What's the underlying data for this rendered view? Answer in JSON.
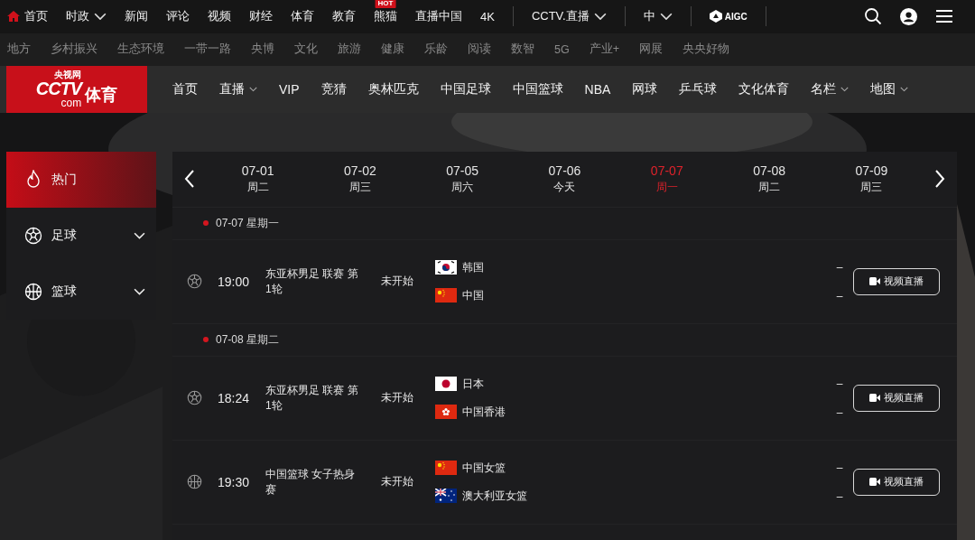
{
  "top_nav": {
    "items": [
      {
        "label": "首页",
        "home": true,
        "menu": false
      },
      {
        "label": "时政",
        "home": false,
        "menu": true
      },
      {
        "label": "新闻",
        "home": false,
        "menu": false
      },
      {
        "label": "评论",
        "home": false,
        "menu": false
      },
      {
        "label": "视频",
        "home": false,
        "menu": false
      },
      {
        "label": "财经",
        "home": false,
        "menu": false
      },
      {
        "label": "体育",
        "home": false,
        "menu": false
      },
      {
        "label": "教育",
        "home": false,
        "menu": false
      },
      {
        "label": "熊猫",
        "home": false,
        "menu": false,
        "badge": "HOT"
      },
      {
        "label": "直播中国",
        "home": false,
        "menu": false
      },
      {
        "label": "4K",
        "home": false,
        "menu": false
      }
    ],
    "live": {
      "label": "CCTV.直播"
    },
    "language": {
      "label": "中"
    },
    "aigc": {
      "label": "AIGC"
    }
  },
  "channel_nav": [
    "地方",
    "乡村振兴",
    "生态环境",
    "一带一路",
    "央博",
    "文化",
    "旅游",
    "健康",
    "乐龄",
    "阅读",
    "数智",
    "5G",
    "产业+",
    "网展",
    "央央好物"
  ],
  "logo": {
    "brand": "CCTV",
    "domain": "com",
    "site": "央视网",
    "section": "体育"
  },
  "sports_nav": [
    {
      "label": "首页",
      "menu": false
    },
    {
      "label": "直播",
      "menu": true
    },
    {
      "label": "VIP",
      "menu": false
    },
    {
      "label": "竞猜",
      "menu": false
    },
    {
      "label": "奥林匹克",
      "menu": false
    },
    {
      "label": "中国足球",
      "menu": false
    },
    {
      "label": "中国篮球",
      "menu": false
    },
    {
      "label": "NBA",
      "menu": false
    },
    {
      "label": "网球",
      "menu": false
    },
    {
      "label": "乒乓球",
      "menu": false
    },
    {
      "label": "文化体育",
      "menu": false
    },
    {
      "label": "名栏",
      "menu": true
    },
    {
      "label": "地图",
      "menu": true
    }
  ],
  "sidebar": {
    "items": [
      {
        "label": "热门",
        "kind": "fire",
        "selected": true,
        "expandable": false
      },
      {
        "label": "足球",
        "kind": "football",
        "selected": false,
        "expandable": true
      },
      {
        "label": "篮球",
        "kind": "basketball",
        "selected": false,
        "expandable": true
      }
    ]
  },
  "dates": [
    {
      "date": "07-01",
      "day": "周二",
      "selected": false
    },
    {
      "date": "07-02",
      "day": "周三",
      "selected": false
    },
    {
      "date": "07-05",
      "day": "周六",
      "selected": false
    },
    {
      "date": "07-06",
      "day": "今天",
      "selected": false
    },
    {
      "date": "07-07",
      "day": "周一",
      "selected": true
    },
    {
      "date": "07-08",
      "day": "周二",
      "selected": false
    },
    {
      "date": "07-09",
      "day": "周三",
      "selected": false
    }
  ],
  "schedule": [
    {
      "heading": "07-07 星期一",
      "matches": [
        {
          "kind": "football",
          "time": "19:00",
          "title": "东亚杯男足 联赛 第1轮",
          "status": "未开始",
          "teams": [
            {
              "name": "韩国",
              "kind": "kr",
              "score": "–"
            },
            {
              "name": "中国",
              "kind": "cn",
              "score": "–"
            }
          ],
          "button": "视频直播"
        }
      ]
    },
    {
      "heading": "07-08 星期二",
      "matches": [
        {
          "kind": "football",
          "time": "18:24",
          "title": "东亚杯男足 联赛 第1轮",
          "status": "未开始",
          "teams": [
            {
              "name": "日本",
              "kind": "jp",
              "score": "–"
            },
            {
              "name": "中国香港",
              "kind": "hk",
              "score": "–"
            }
          ],
          "button": "视频直播"
        },
        {
          "kind": "basketball",
          "time": "19:30",
          "title": "中国篮球 女子热身赛",
          "status": "未开始",
          "teams": [
            {
              "name": "中国女篮",
              "kind": "cn",
              "score": "–"
            },
            {
              "name": "澳大利亚女篮",
              "kind": "au",
              "score": "–"
            }
          ],
          "button": "视频直播"
        }
      ]
    }
  ]
}
